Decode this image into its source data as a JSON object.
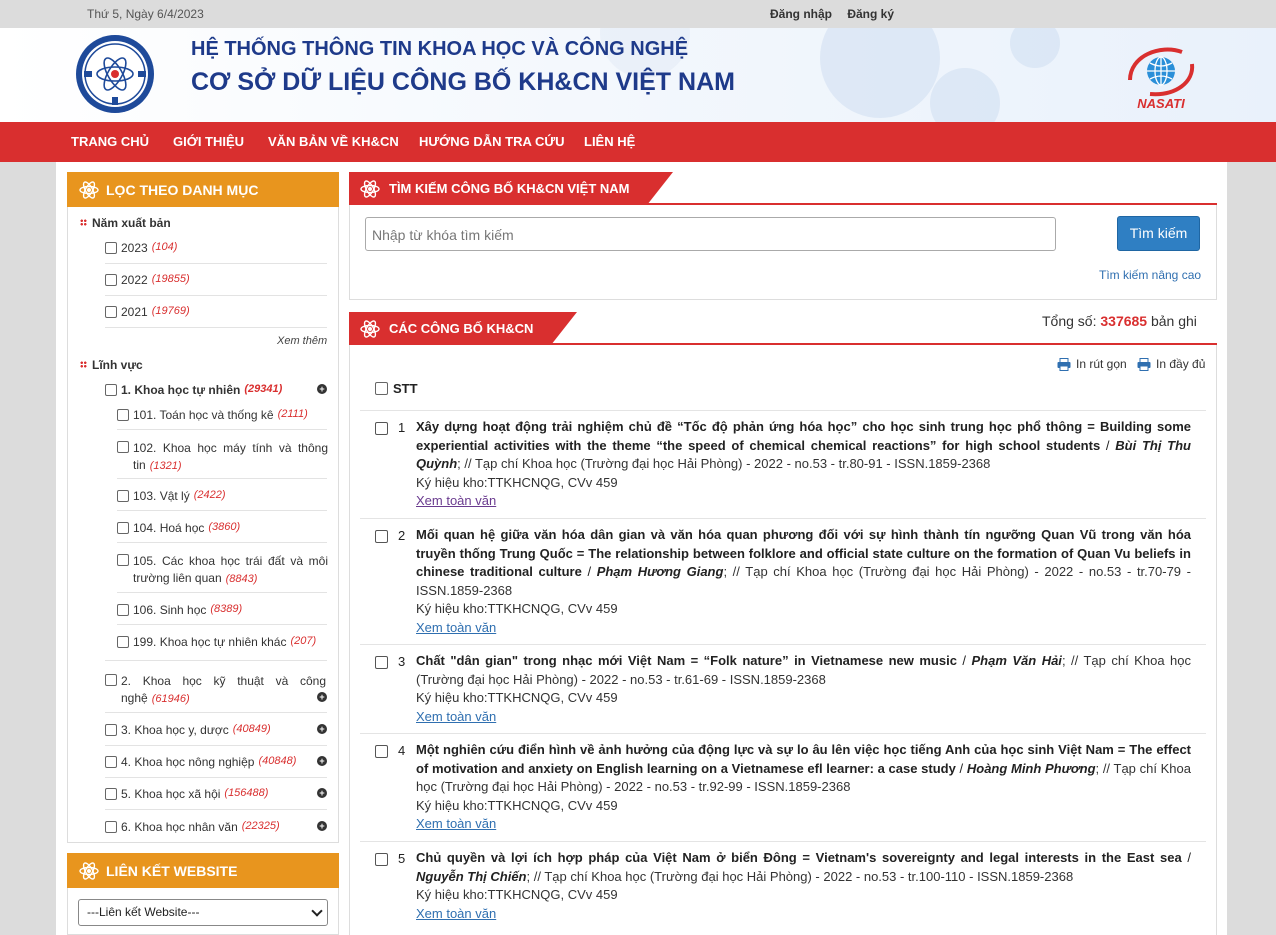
{
  "topbar": {
    "date": "Thứ 5, Ngày 6/4/2023",
    "login": "Đăng nhập",
    "register": "Đăng ký"
  },
  "header": {
    "title1": "HỆ THỐNG THÔNG TIN KHOA HỌC VÀ CÔNG NGHỆ",
    "title2": "CƠ SỞ DỮ LIỆU CÔNG BỐ KH&CN VIỆT NAM",
    "logo_left_text": "BỘ KHOA HỌC VÀ CÔNG NGHỆ",
    "logo_right_text": "NASATI"
  },
  "nav": [
    "TRANG CHỦ",
    "GIỚI THIỆU",
    "VĂN BẢN VỀ KH&CN",
    "HƯỚNG DẪN TRA CỨU",
    "LIÊN HỆ"
  ],
  "filter": {
    "title": "LỌC THEO DANH MỤC",
    "year_title": "Năm xuất bản",
    "years": [
      {
        "label": "2023",
        "count": "(104)"
      },
      {
        "label": "2022",
        "count": "(19855)"
      },
      {
        "label": "2021",
        "count": "(19769)"
      }
    ],
    "see_more": "Xem thêm",
    "field_title": "Lĩnh vực",
    "fields": [
      {
        "label": "1. Khoa học tự nhiên",
        "count": "(29341)"
      },
      {
        "label": "101. Toán học và thống kê",
        "count": "(2111)"
      },
      {
        "label": "102. Khoa học máy tính và thông tin",
        "count": "(1321)"
      },
      {
        "label": "103. Vật lý",
        "count": "(2422)"
      },
      {
        "label": "104. Hoá học",
        "count": "(3860)"
      },
      {
        "label": "105. Các khoa học trái đất và môi trường liên quan",
        "count": "(8843)"
      },
      {
        "label": "106. Sinh học",
        "count": "(8389)"
      },
      {
        "label": "199. Khoa học tự nhiên khác",
        "count": "(207)"
      },
      {
        "label": "2. Khoa học kỹ thuật và công nghệ",
        "count": "(61946)"
      },
      {
        "label": "3. Khoa học y, dược",
        "count": "(40849)"
      },
      {
        "label": "4. Khoa học nông nghiệp",
        "count": "(40848)"
      },
      {
        "label": "5. Khoa học xã hội",
        "count": "(156488)"
      },
      {
        "label": "6. Khoa học nhân văn",
        "count": "(22325)"
      }
    ]
  },
  "links": {
    "title": "LIÊN KẾT WEBSITE",
    "selected": "---Liên kết Website---"
  },
  "search": {
    "title": "TÌM KIẾM CÔNG BỐ KH&CN VIỆT NAM",
    "placeholder": "Nhập từ khóa tìm kiếm",
    "button": "Tìm kiếm",
    "advanced": "Tìm kiếm nâng cao"
  },
  "results": {
    "title": "CÁC CÔNG BỐ KH&CN",
    "total_label": "Tổng số:",
    "total_value": "337685",
    "total_unit": "bản ghi",
    "print_short": "In rút gọn",
    "print_full": "In đầy đủ",
    "stt": "STT",
    "items": [
      {
        "num": "1",
        "title": "Xây dựng hoạt động trải nghiệm chủ đề “Tốc độ phản ứng hóa học” cho học sinh trung học phổ thông = Building some experiential activities with the theme “the speed of chemical chemical reactions” for high school students",
        "sep": " / ",
        "author": "Bùi Thị Thu Quỳnh",
        "meta": "; // Tạp chí Khoa học (Trường đại học Hải Phòng) - 2022 - no.53 - tr.80-91 - ISSN.1859-2368",
        "code": "Ký hiệu kho:TTKHCNQG, CVv 459",
        "more": "Xem toàn văn"
      },
      {
        "num": "2",
        "title": "Mối quan hệ giữa văn hóa dân gian và văn hóa quan phương đối với sự hình thành tín ngưỡng Quan Vũ trong văn hóa truyền thống Trung Quốc = The relationship between folklore and official state culture on the formation of Quan Vu beliefs in chinese traditional culture",
        "sep": " / ",
        "author": "Phạm Hương Giang",
        "meta": "; // Tạp chí Khoa học (Trường đại học Hải Phòng) - 2022 - no.53 - tr.70-79 - ISSN.1859-2368",
        "code": "Ký hiệu kho:TTKHCNQG, CVv 459",
        "more": "Xem toàn văn"
      },
      {
        "num": "3",
        "title": "Chất \"dân gian\" trong nhạc mới Việt Nam = “Folk nature” in Vietnamese new music",
        "sep": " / ",
        "author": "Phạm Văn Hải",
        "meta": "; // Tạp chí Khoa học (Trường đại học Hải Phòng) - 2022 - no.53 - tr.61-69 - ISSN.1859-2368",
        "code": "Ký hiệu kho:TTKHCNQG, CVv 459",
        "more": "Xem toàn văn"
      },
      {
        "num": "4",
        "title": "Một nghiên cứu điển hình về ảnh hưởng của động lực và sự lo âu lên việc học tiếng Anh của học sinh Việt Nam = The effect of motivation and anxiety on English learning on a Vietnamese efl learner: a case study",
        "sep": " / ",
        "author": "Hoàng Minh Phương",
        "meta": "; // Tạp chí Khoa học (Trường đại học Hải Phòng) - 2022 - no.53 - tr.92-99 - ISSN.1859-2368",
        "code": "Ký hiệu kho:TTKHCNQG, CVv 459",
        "more": "Xem toàn văn"
      },
      {
        "num": "5",
        "title": "Chủ quyền và lợi ích hợp pháp của Việt Nam ở biển Đông = Vietnam's sovereignty and legal interests in the East sea",
        "sep": " / ",
        "author": "Nguyễn Thị Chiến",
        "meta": "; // Tạp chí Khoa học (Trường đại học Hải Phòng) - 2022 - no.53 - tr.100-110 - ISSN.1859-2368",
        "code": "Ký hiệu kho:TTKHCNQG, CVv 459",
        "more": "Xem toàn văn"
      }
    ]
  },
  "colors": {
    "brand_red": "#d92f2f",
    "filter_orange": "#e8951e",
    "title_blue": "#1e3a8a",
    "link_blue": "#2f6fb0"
  }
}
